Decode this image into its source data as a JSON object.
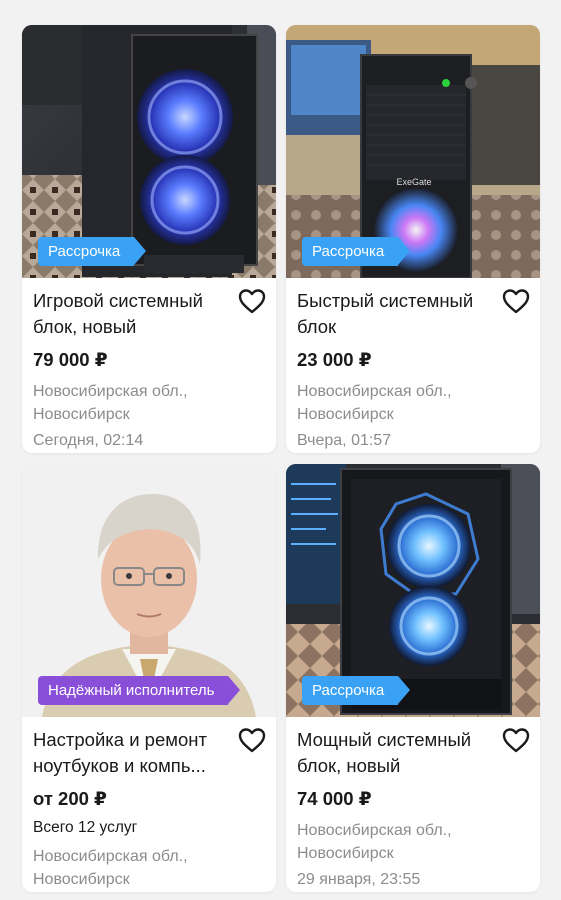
{
  "listings": [
    {
      "badge": "Рассрочка",
      "title": "Игровой системный блок, новый",
      "price": "79 000 ₽",
      "location_line1": "Новосибирская обл.,",
      "location_line2": "Новосибирск",
      "date": "Сегодня, 02:14",
      "favorite_icon": "heart-outline-icon",
      "photo_icon": "pc-case-photo"
    },
    {
      "badge": "Рассрочка",
      "title": "Быстрый системный блок",
      "price": "23 000 ₽",
      "location_line1": "Новосибирская обл.,",
      "location_line2": "Новосибирск",
      "date": "Вчера, 01:57",
      "favorite_icon": "heart-outline-icon",
      "photo_icon": "pc-case-photo",
      "case_brand": "ExeGate"
    },
    {
      "badge": "Надёжный исполнитель",
      "title": "Настройка и ремонт ноутбуков и компь...",
      "price": "от 200 ₽",
      "services": "Всего 12 услуг",
      "location_line1": "Новосибирская обл.,",
      "location_line2": "Новосибирск",
      "favorite_icon": "heart-outline-icon",
      "photo_icon": "person-portrait-photo"
    },
    {
      "badge": "Рассрочка",
      "title": "Мощный системный блок, новый",
      "price": "74 000 ₽",
      "location_line1": "Новосибирская обл.,",
      "location_line2": "Новосибирск",
      "date": "29 января, 23:55",
      "favorite_icon": "heart-outline-icon",
      "photo_icon": "pc-case-photo"
    }
  ],
  "colors": {
    "installment_badge": "#3aa2f5",
    "reliable_badge": "#8a4fd8",
    "muted_text": "#8c8c8c",
    "text": "#1a1a1a"
  }
}
